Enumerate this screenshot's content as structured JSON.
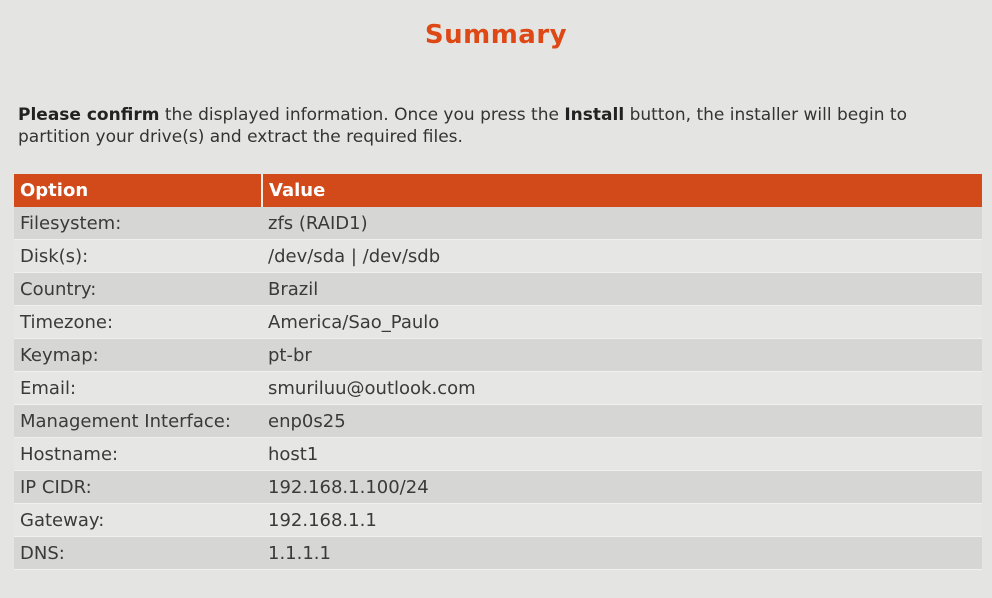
{
  "header": {
    "title": "Summary"
  },
  "intro": {
    "bold_prefix": "Please confirm",
    "text_before_button": " the displayed information. Once you press the ",
    "button_name": "Install",
    "text_after_button": " button, the installer will begin to partition your drive(s) and extract the required files."
  },
  "table": {
    "headers": {
      "option": "Option",
      "value": "Value"
    },
    "rows": [
      {
        "option": "Filesystem:",
        "value": "zfs (RAID1)"
      },
      {
        "option": "Disk(s):",
        "value": "/dev/sda | /dev/sdb"
      },
      {
        "option": "Country:",
        "value": "Brazil"
      },
      {
        "option": "Timezone:",
        "value": "America/Sao_Paulo"
      },
      {
        "option": "Keymap:",
        "value": "pt-br"
      },
      {
        "option": "Email:",
        "value": "smuriluu@outlook.com"
      },
      {
        "option": "Management Interface:",
        "value": "enp0s25"
      },
      {
        "option": "Hostname:",
        "value": "host1"
      },
      {
        "option": "IP CIDR:",
        "value": "192.168.1.100/24"
      },
      {
        "option": "Gateway:",
        "value": "192.168.1.1"
      },
      {
        "option": "DNS:",
        "value": "1.1.1.1"
      }
    ]
  },
  "colors": {
    "accent": "#dd4814",
    "header_row": "#d2491a"
  }
}
